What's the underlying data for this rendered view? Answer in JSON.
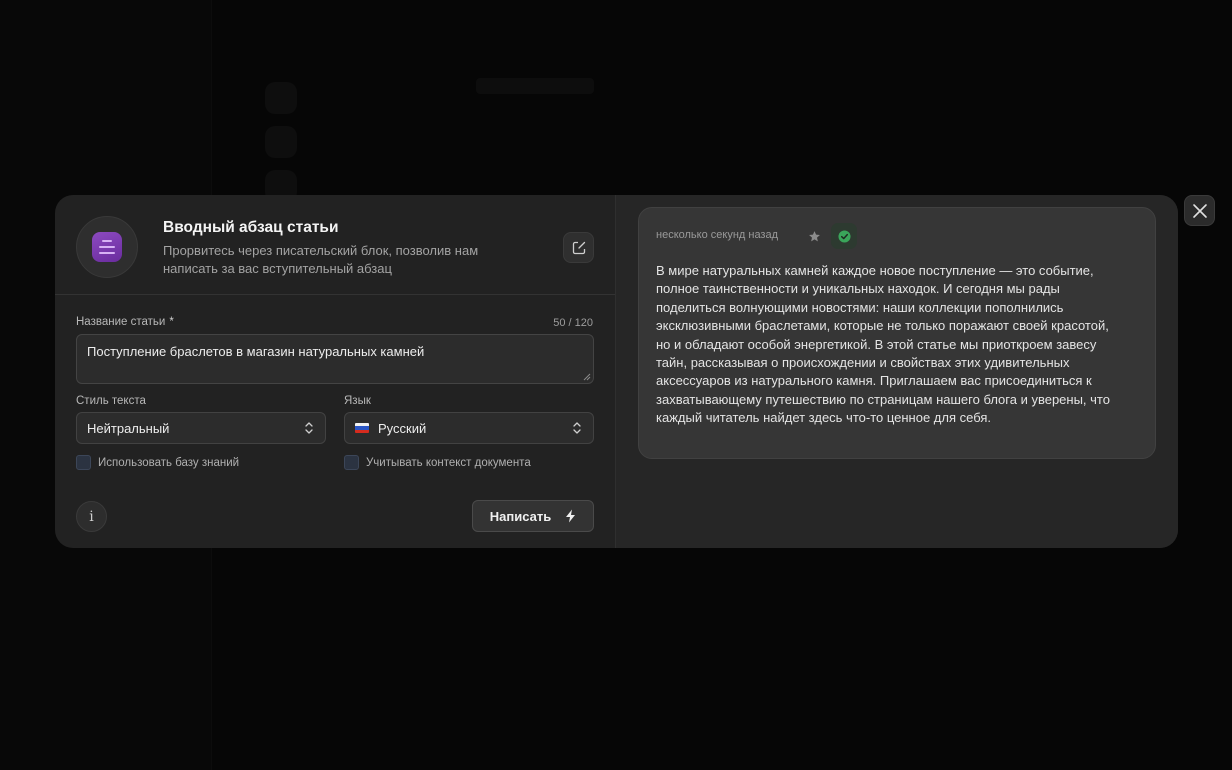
{
  "modal": {
    "title": "Вводный абзац статьи",
    "subtitle": "Прорвитесь через писательский блок, позволив нам написать за вас вступительный абзац",
    "icon": "text-block-icon",
    "accent": "#7b3cb0"
  },
  "form": {
    "article_title_label": "Название статьи",
    "required_mark": "*",
    "counter": "50 / 120",
    "article_title_value": "Поступление браслетов в магазин натуральных камней",
    "style_label": "Стиль текста",
    "style_value": "Нейтральный",
    "language_label": "Язык",
    "language_value": "Русский",
    "language_flag": "ru-flag-icon",
    "knowledge_base_label": "Использовать базу знаний",
    "knowledge_base_checked": false,
    "doc_context_label": "Учитывать контекст документа",
    "doc_context_checked": false,
    "info_symbol": "i",
    "write_button_label": "Написать"
  },
  "result": {
    "timestamp": "несколько секунд назад",
    "text": "В мире натуральных камней каждое новое поступление — это событие, полное таинственности и уникальных находок. И сегодня мы рады поделиться волнующими новостями: наши коллекции пополнились эксклюзивными браслетами, которые не только поражают своей красотой, но и обладают особой энергетикой. В этой статье мы приоткроем завесу тайн, рассказывая о происхождении и свойствах этих удивительных аксессуаров из натурального камня. Приглашаем вас присоединиться к захватывающему путешествию по страницам нашего блога и уверены, что каждый читатель найдет здесь что-то ценное для себя."
  },
  "colors": {
    "modal_bg": "#222222",
    "card_bg": "#363636",
    "success": "#3aa55a"
  }
}
